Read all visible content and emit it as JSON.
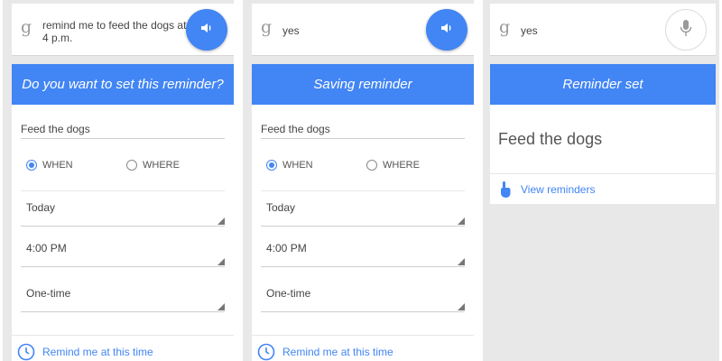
{
  "colors": {
    "accent": "#4285f4",
    "panel_bg": "#e8e8e8"
  },
  "panels": [
    {
      "query": "remind me to feed the dogs at 4 p.m.",
      "header": "Do you want to set this reminder?",
      "title_field": "Feed the dogs",
      "when_label": "WHEN",
      "where_label": "WHERE",
      "date_value": "Today",
      "time_value": "4:00 PM",
      "repeat_value": "One-time",
      "footer_link": "Remind me at this time"
    },
    {
      "query": "yes",
      "header": "Saving reminder",
      "title_field": "Feed the dogs",
      "when_label": "WHEN",
      "where_label": "WHERE",
      "date_value": "Today",
      "time_value": "4:00 PM",
      "repeat_value": "One-time",
      "footer_link": "Remind me at this time"
    },
    {
      "query": "yes",
      "header": "Reminder set",
      "title": "Feed the dogs",
      "view_link": "View reminders"
    }
  ],
  "logo_char": "g"
}
